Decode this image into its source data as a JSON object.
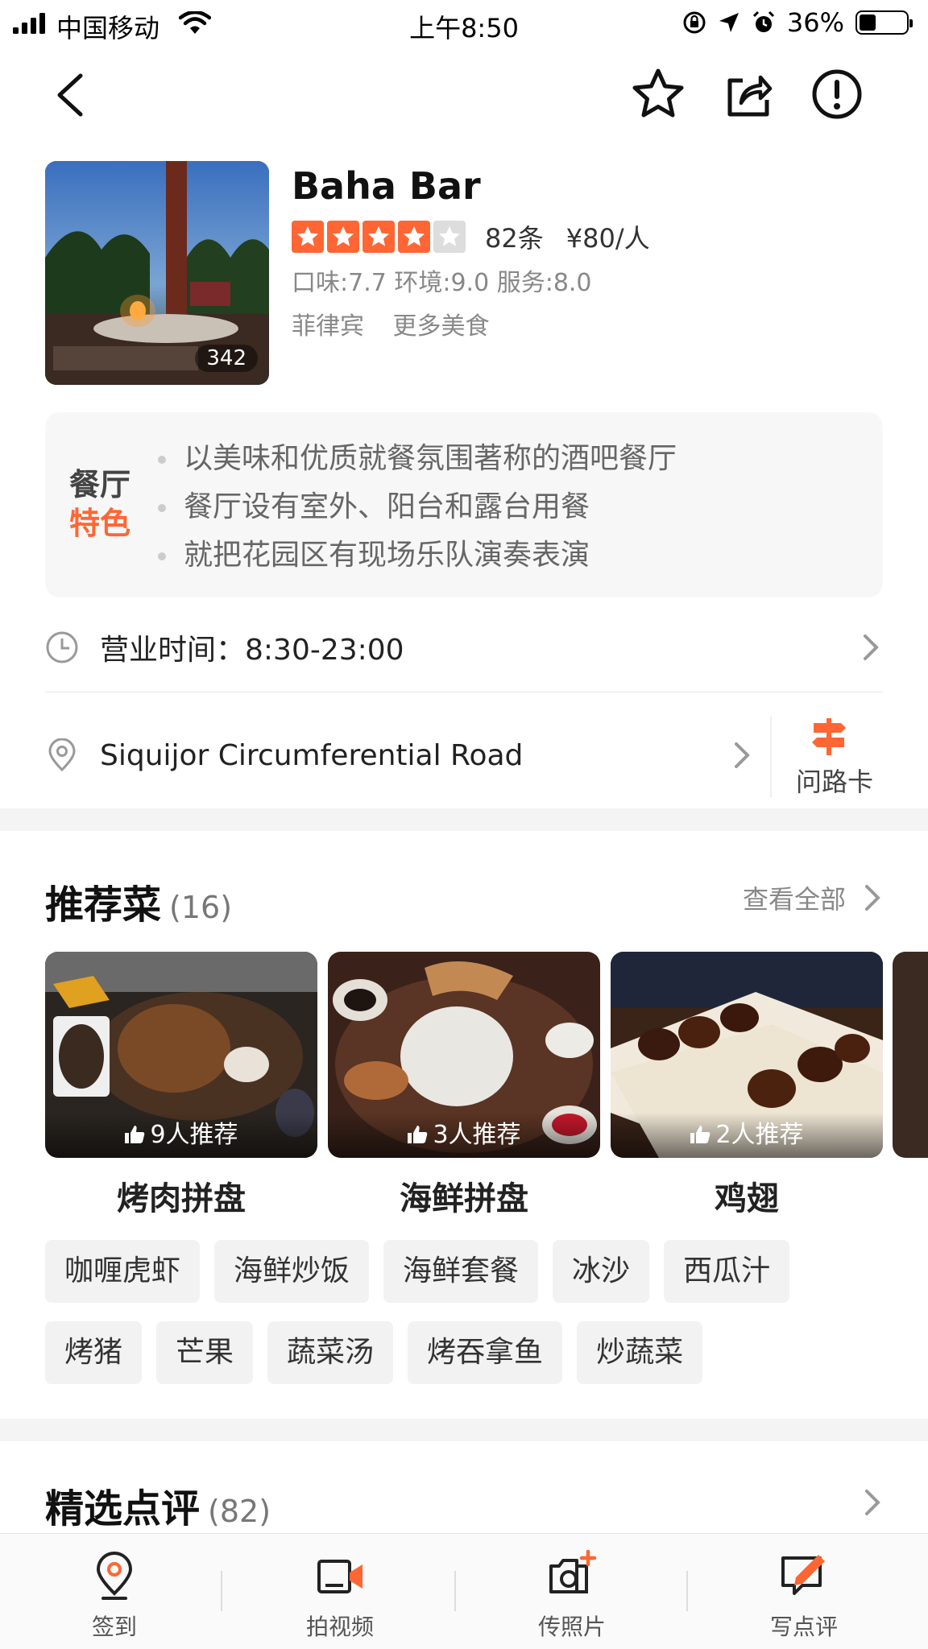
{
  "status_bar": {
    "carrier": "中国移动",
    "time": "上午8:50",
    "battery": "36%"
  },
  "restaurant": {
    "name": "Baha Bar",
    "photo_count": "342",
    "stars": 4,
    "review_count": "82条",
    "price": "¥80/人",
    "scores": "口味:7.7 环境:9.0 服务:8.0",
    "tags": [
      "菲律宾",
      "更多美食"
    ]
  },
  "features": {
    "badge_line1": "餐厅",
    "badge_line2": "特色",
    "items": [
      "以美味和优质就餐氛围著称的酒吧餐厅",
      "餐厅设有室外、阳台和露台用餐",
      "就把花园区有现场乐队演奏表演"
    ]
  },
  "hours": {
    "text": "营业时间：8:30-23:00"
  },
  "address": {
    "text": "Siquijor Circumferential Road",
    "map_card_label": "问路卡"
  },
  "recommended": {
    "title": "推荐菜",
    "count": "(16)",
    "see_all": "查看全部",
    "dishes": [
      {
        "name": "烤肉拼盘",
        "recommend": "9人推荐"
      },
      {
        "name": "海鲜拼盘",
        "recommend": "3人推荐"
      },
      {
        "name": "鸡翅",
        "recommend": "2人推荐"
      }
    ],
    "chips_row1": [
      "咖喱虎虾",
      "海鲜炒饭",
      "海鲜套餐",
      "冰沙",
      "西瓜汁"
    ],
    "chips_row2": [
      "烤猪",
      "芒果",
      "蔬菜汤",
      "烤吞拿鱼",
      "炒蔬菜"
    ]
  },
  "reviews_section": {
    "title": "精选点评",
    "count": "(82)"
  },
  "tabbar": {
    "items": [
      "签到",
      "拍视频",
      "传照片",
      "写点评"
    ]
  },
  "colors": {
    "accent": "#ff6633"
  }
}
